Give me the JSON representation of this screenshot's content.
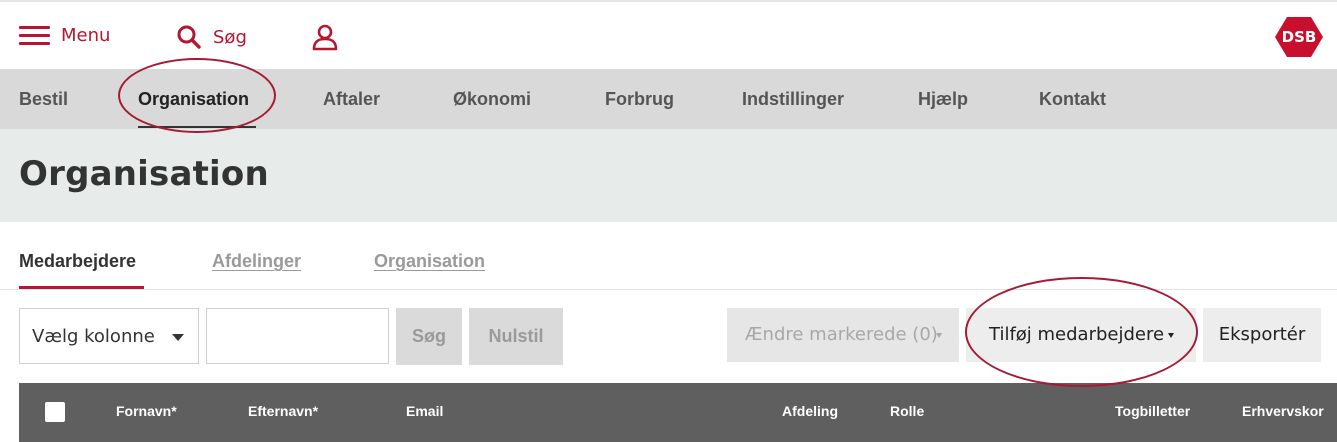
{
  "topbar": {
    "menu_label": "Menu",
    "search_label": "Søg",
    "logo_text": "DSB",
    "brand_color": "#b41730",
    "icons": [
      "hamburger-icon",
      "search-icon",
      "user-icon"
    ]
  },
  "mainnav": {
    "items": [
      {
        "label": "Bestil"
      },
      {
        "label": "Organisation",
        "active": true
      },
      {
        "label": "Aftaler"
      },
      {
        "label": "Økonomi"
      },
      {
        "label": "Forbrug"
      },
      {
        "label": "Indstillinger"
      },
      {
        "label": "Hjælp"
      },
      {
        "label": "Kontakt"
      }
    ]
  },
  "page": {
    "title": "Organisation"
  },
  "subtabs": {
    "items": [
      {
        "label": "Medarbejdere",
        "active": true
      },
      {
        "label": "Afdelinger"
      },
      {
        "label": "Organisation"
      }
    ]
  },
  "toolbar": {
    "column_select": "Vælg kolonne",
    "search_value": "",
    "search_button": "Søg",
    "reset_button": "Nulstil",
    "change_selected": "Ændre markerede (0)",
    "add_employees": "Tilføj medarbejdere",
    "export": "Eksportér"
  },
  "table": {
    "columns": [
      "Fornavn*",
      "Efternavn*",
      "Email",
      "Afdeling",
      "Rolle",
      "Togbilletter",
      "Erhvervskort"
    ]
  }
}
